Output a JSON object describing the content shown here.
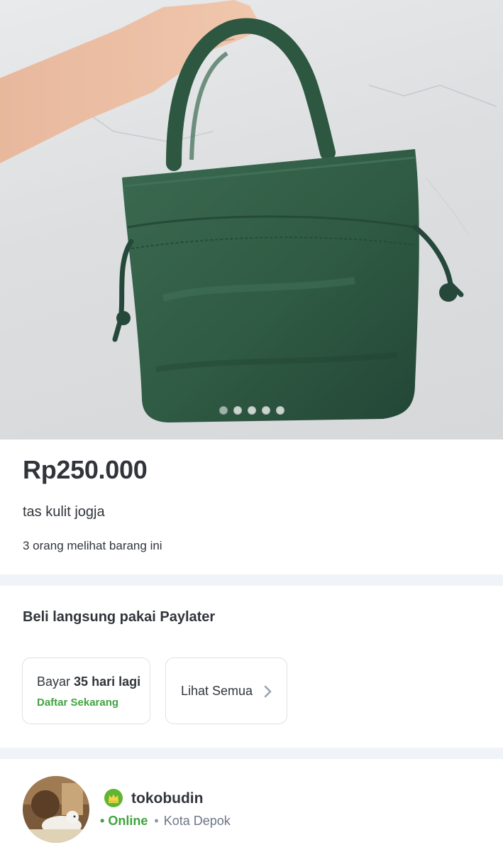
{
  "product": {
    "image_alt": "tas kulit jogja",
    "image_count": 5,
    "active_image": 1,
    "price": "Rp250.000",
    "title": "tas kulit jogja",
    "viewers": "3 orang melihat barang ini"
  },
  "paylater": {
    "title": "Beli langsung pakai Paylater",
    "pay_prefix": "Bayar",
    "pay_days": "35 hari lagi",
    "pay_cta": "Daftar Sekarang",
    "see_all": "Lihat Semua",
    "see_all_icon": "chevron-right-icon"
  },
  "shop": {
    "badge_icon": "crown-badge-icon",
    "name": "tokobudin",
    "bullet": "•",
    "status": "Online",
    "separator": "•",
    "city": "Kota Depok"
  },
  "colors": {
    "text_primary": "#31353b",
    "accent_green": "#3fa33f",
    "divider": "#f0f3f7",
    "card_border": "#dde1e7",
    "bag_green": "#2f5a43"
  }
}
